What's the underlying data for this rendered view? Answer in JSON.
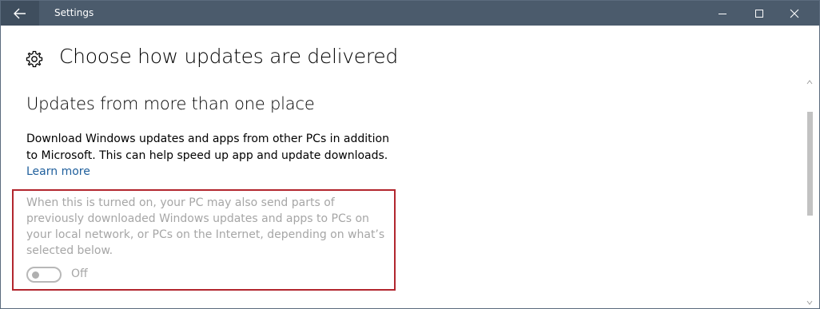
{
  "window": {
    "title": "Settings"
  },
  "icons": {
    "back": "back-arrow-icon",
    "minimize": "minimize-icon",
    "maximize": "maximize-icon",
    "close": "close-icon",
    "settings": "gear-icon"
  },
  "page": {
    "title": "Choose how updates are delivered",
    "section_title": "Updates from more than one place",
    "description": "Download Windows updates and apps from other PCs in addition to Microsoft. This can help speed up app and update downloads.",
    "learn_more": "Learn more",
    "disabled_text": "When this is turned on, your PC may also send parts of previously downloaded Windows updates and apps to PCs on your local network, or PCs on the Internet, depending on what’s selected below.",
    "toggle_state": "Off"
  },
  "colors": {
    "titlebar": "#4b5b6c",
    "link": "#1f5f9c",
    "highlight": "#b2262e",
    "disabled_text": "#a6a6a6"
  }
}
